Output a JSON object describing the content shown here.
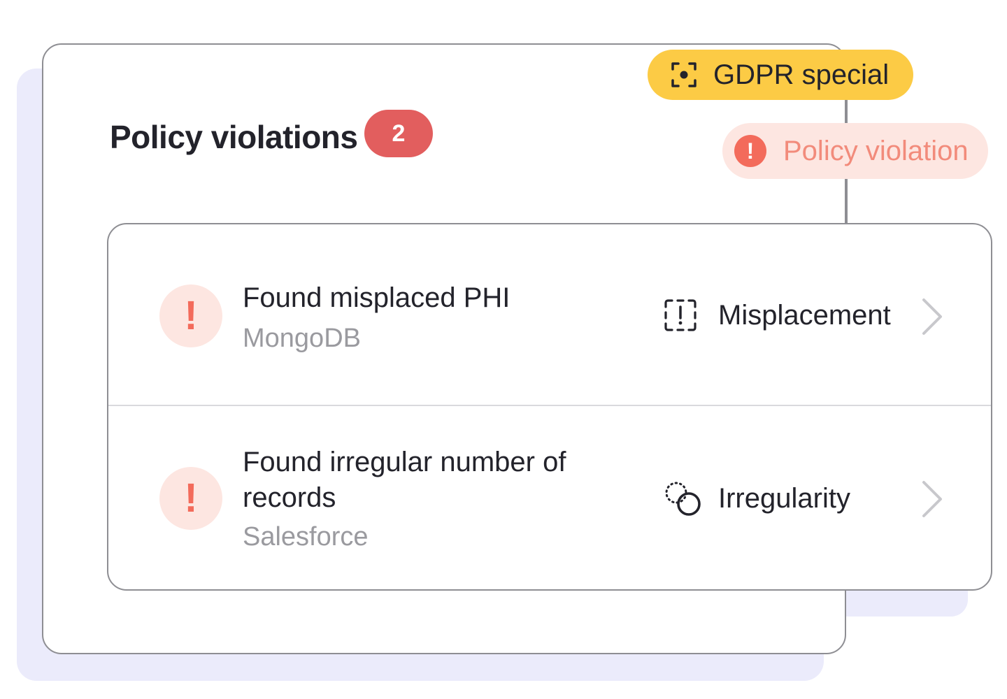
{
  "header": {
    "title": "Policy violations",
    "count": "2"
  },
  "tags": {
    "gdpr": {
      "label": "GDPR special",
      "icon": "focus-target-icon",
      "color": "#fccb45"
    },
    "policy": {
      "label": "Policy violation",
      "icon": "alert-circle-icon",
      "color": "#fde6e1",
      "text_color": "#f28b7b"
    }
  },
  "violations": [
    {
      "title": "Found misplaced PHI",
      "source": "MongoDB",
      "category": "Misplacement",
      "category_icon": "misplacement-icon"
    },
    {
      "title": "Found irregular number of records",
      "source": "Salesforce",
      "category": "Irregularity",
      "category_icon": "irregularity-icon"
    }
  ],
  "colors": {
    "badge": "#e25e5e",
    "alert": "#f36b5b",
    "backdrop": "#ebebfb"
  }
}
